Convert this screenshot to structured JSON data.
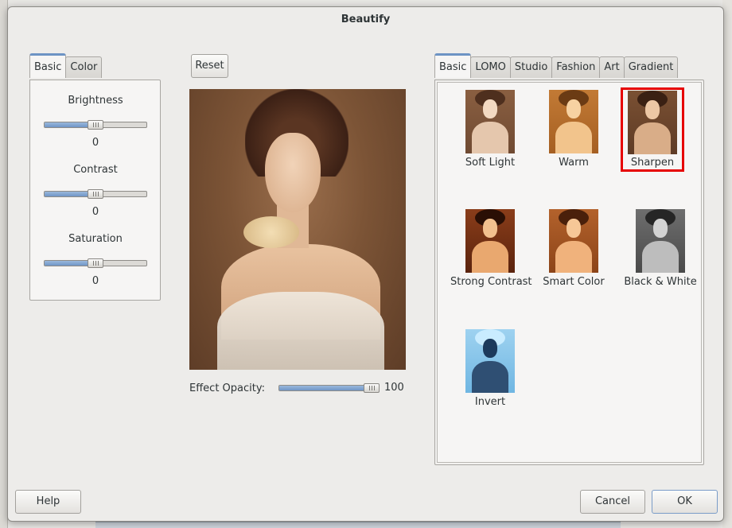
{
  "window": {
    "title": "Beautify"
  },
  "adjust": {
    "tabs": [
      "Basic",
      "Color"
    ],
    "active_tab": "Basic",
    "sliders": [
      {
        "label": "Brightness",
        "value": "0",
        "level": 0.5
      },
      {
        "label": "Contrast",
        "value": "0",
        "level": 0.5
      },
      {
        "label": "Saturation",
        "value": "0",
        "level": 0.5
      }
    ]
  },
  "preview": {
    "reset_label": "Reset",
    "opacity_label": "Effect Opacity:",
    "opacity_value": "100",
    "opacity_level": 1.0
  },
  "effects": {
    "tabs": [
      "Basic",
      "LOMO",
      "Studio",
      "Fashion",
      "Art",
      "Gradient"
    ],
    "active_tab": "Basic",
    "items": [
      {
        "label": "Soft Light",
        "tone": "soft"
      },
      {
        "label": "Warm",
        "tone": "warm"
      },
      {
        "label": "Sharpen",
        "tone": "sharpen",
        "selected": true
      },
      {
        "label": "Strong Contrast",
        "tone": "strong"
      },
      {
        "label": "Smart Color",
        "tone": "smart"
      },
      {
        "label": "Black & White",
        "tone": "bw"
      },
      {
        "label": "Invert",
        "tone": "invert"
      }
    ]
  },
  "footer": {
    "help_label": "Help",
    "cancel_label": "Cancel",
    "ok_label": "OK"
  },
  "colors": {
    "accent": "#6d93c4",
    "selection": "#e60000"
  }
}
